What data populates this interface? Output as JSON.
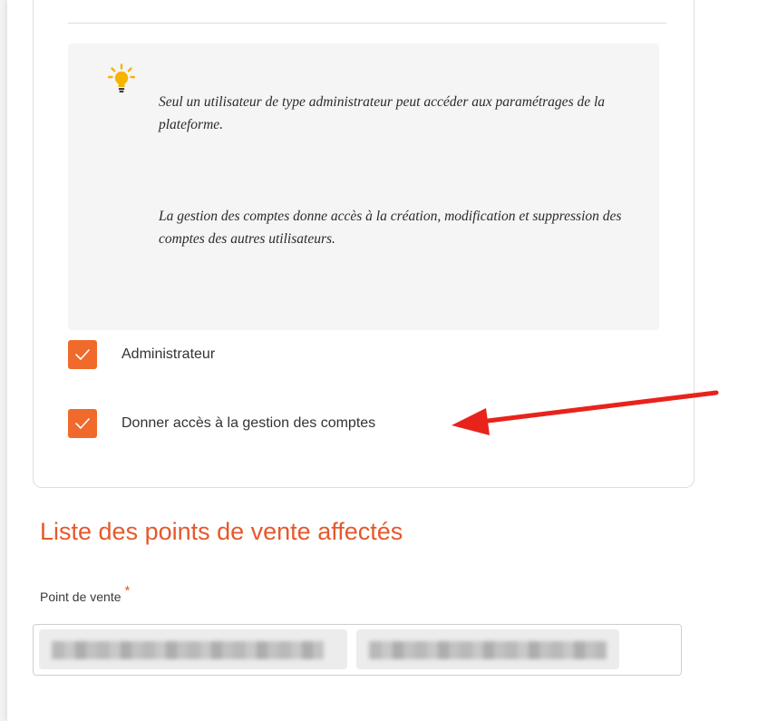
{
  "info_box": {
    "paragraph_1": "Seul un utilisateur de type administrateur peut accéder aux paramétrages de la plateforme.",
    "paragraph_2": "La gestion des comptes donne accès à la création, modification et suppression des comptes des autres utilisateurs.",
    "icon": "lightbulb-icon"
  },
  "checkboxes": [
    {
      "label": "Administrateur",
      "checked": true
    },
    {
      "label": "Donner accès à la gestion des comptes",
      "checked": true
    }
  ],
  "section": {
    "title": "Liste des points de vente affectés"
  },
  "point_de_vente": {
    "label": "Point de vente",
    "required_marker": "*"
  },
  "colors": {
    "accent": "#ef6a2b",
    "title": "#e4592c",
    "annotation_arrow": "#e8231c"
  }
}
